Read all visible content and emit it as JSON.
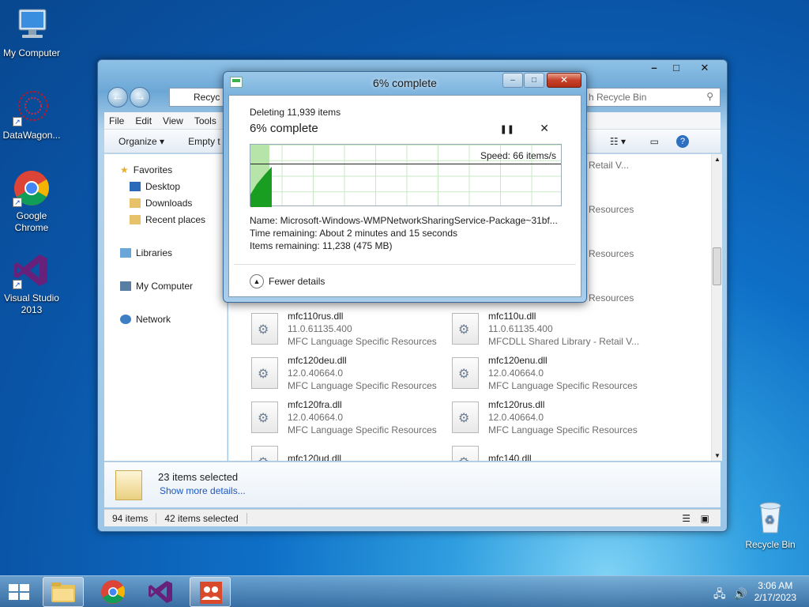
{
  "desktop": {
    "icons": [
      {
        "label": "My Computer"
      },
      {
        "label": "DataWagon..."
      },
      {
        "label": "Google Chrome"
      },
      {
        "label": "Visual Studio 2013"
      },
      {
        "label": "Recycle Bin"
      }
    ]
  },
  "explorer": {
    "address": "Recyc",
    "search_placeholder": "h Recycle Bin",
    "menu": [
      "File",
      "Edit",
      "View",
      "Tools"
    ],
    "toolbar": {
      "organize": "Organize ▾",
      "empty": "Empty t"
    },
    "nav": {
      "favorites": "Favorites",
      "desktop": "Desktop",
      "downloads": "Downloads",
      "recent": "Recent places",
      "libraries": "Libraries",
      "my_computer": "My Computer",
      "network": "Network"
    },
    "partial_texts": [
      "Retail V...",
      "Resources",
      "Resources",
      "Resources"
    ],
    "files": [
      {
        "name": "mfc110rus.dll",
        "version": "11.0.61135.400",
        "desc": "MFC Language Specific Resources"
      },
      {
        "name": "mfc110u.dll",
        "version": "11.0.61135.400",
        "desc": "MFCDLL Shared Library - Retail V..."
      },
      {
        "name": "mfc120deu.dll",
        "version": "12.0.40664.0",
        "desc": "MFC Language Specific Resources"
      },
      {
        "name": "mfc120enu.dll",
        "version": "12.0.40664.0",
        "desc": "MFC Language Specific Resources"
      },
      {
        "name": "mfc120fra.dll",
        "version": "12.0.40664.0",
        "desc": "MFC Language Specific Resources"
      },
      {
        "name": "mfc120rus.dll",
        "version": "12.0.40664.0",
        "desc": "MFC Language Specific Resources"
      },
      {
        "name": "mfc120ud.dll"
      },
      {
        "name": "mfc140.dll"
      }
    ],
    "details": {
      "selected": "23 items selected",
      "more": "Show more details..."
    },
    "status": {
      "items": "94 items",
      "selected": "42 items selected"
    }
  },
  "dialog": {
    "title": "6% complete",
    "deleting": "Deleting 11,939 items",
    "percent": "6% complete",
    "progress": 0.06,
    "speed": "Speed: 66 items/s",
    "name": "Name:  Microsoft-Windows-WMPNetworkSharingService-Package~31bf...",
    "time_remaining": "Time remaining:  About 2 minutes and 15 seconds",
    "items_remaining": "Items remaining:  11,238 (475 MB)",
    "fewer_details": "Fewer details",
    "pause_icon": "pause-icon",
    "cancel_icon": "close-icon"
  },
  "taskbar": {
    "time": "3:06 AM",
    "date": "2/17/2023"
  },
  "colors": {
    "progress_fill": "#b7e5a9",
    "progress_wave": "#1a9e22",
    "accent": "#1a56c4"
  }
}
